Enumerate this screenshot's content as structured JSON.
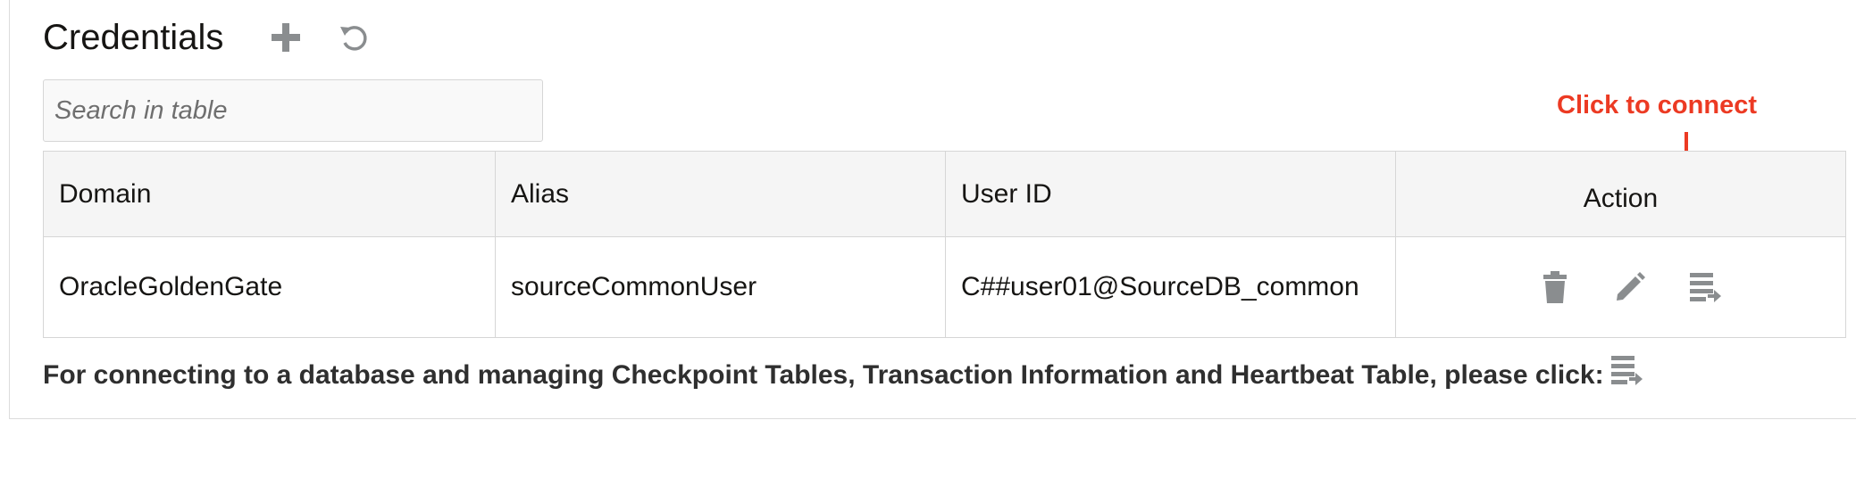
{
  "page": {
    "title": "Credentials"
  },
  "toolbar": {
    "add_icon": "plus-icon",
    "refresh_icon": "refresh-icon"
  },
  "search": {
    "placeholder": "Search in table",
    "value": ""
  },
  "annotation": {
    "text": "Click to connect",
    "color": "#ec3a23"
  },
  "table": {
    "columns": [
      "Domain",
      "Alias",
      "User ID",
      "Action"
    ],
    "rows": [
      {
        "domain": "OracleGoldenGate",
        "alias": "sourceCommonUser",
        "user_id": "C##user01@SourceDB_common",
        "actions": [
          "trash-icon",
          "pencil-icon",
          "connect-db-icon"
        ]
      }
    ]
  },
  "footer": {
    "note": "For connecting to a database and managing Checkpoint Tables, Transaction Information and Heartbeat Table, please click:",
    "icon": "connect-db-icon"
  },
  "colors": {
    "icon_gray": "#8a8d8f",
    "header_bg": "#f5f5f5",
    "border": "#d6d6d6",
    "annotation_red": "#ec3a23"
  }
}
